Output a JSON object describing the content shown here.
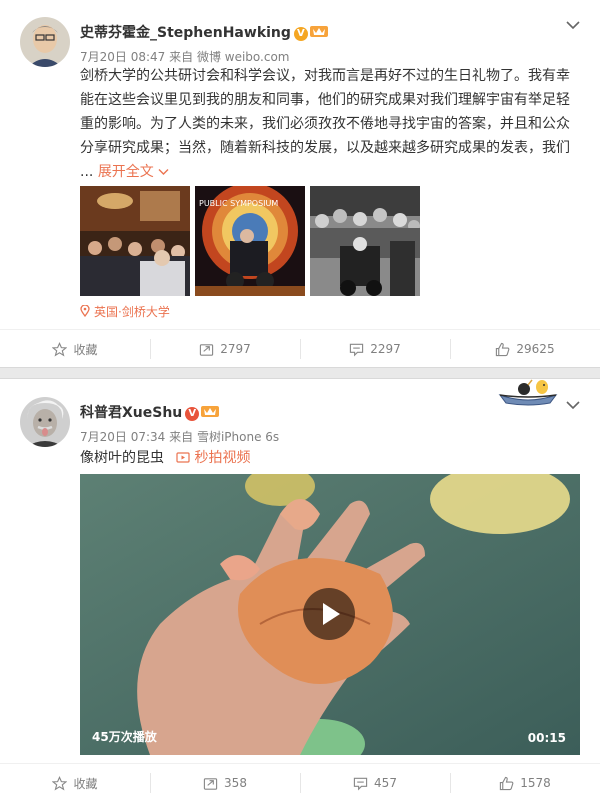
{
  "post1": {
    "author": "史蒂芬霍金_StephenHawking",
    "time": "7月20日 08:47",
    "source": "来自 微博 weibo.com",
    "text": "剑桥大学的公共研讨会和科学会议，对我而言是再好不过的生日礼物了。我有幸能在这些会议里见到我的朋友和同事，他们的研究成果对我们理解宇宙有举足轻重的影响。为了人类的未来，我们必须孜孜不倦地寻找宇宙的答案，并且和公众分享研究成果；当然，随着新科技的发展，以及越来越多研究成果的发表，我们",
    "ellipsis": "...",
    "expand": "展开全文",
    "location": "英国·剑桥大学",
    "thumb_banner": "PUBLIC SYMPOSIUM",
    "actions": {
      "favorite": "收藏",
      "repost": "2797",
      "comment": "2297",
      "like": "29625"
    }
  },
  "post2": {
    "author": "科普君XueShu",
    "time": "7月20日 07:34",
    "source": "来自 雪树iPhone 6s",
    "text": "像树叶的昆虫",
    "video_link": "秒拍视频",
    "views": "45万次播放",
    "duration": "00:15",
    "actions": {
      "favorite": "收藏",
      "repost": "358",
      "comment": "457",
      "like": "1578"
    }
  },
  "colors": {
    "accent": "#eb7350",
    "verified": "#f5a623",
    "meta": "#808080"
  },
  "icons": [
    "chevron-down-icon",
    "verified-icon",
    "vip-crown-icon",
    "location-pin-icon",
    "star-icon",
    "repost-icon",
    "comment-icon",
    "thumbs-up-icon",
    "play-icon",
    "video-link-icon"
  ]
}
